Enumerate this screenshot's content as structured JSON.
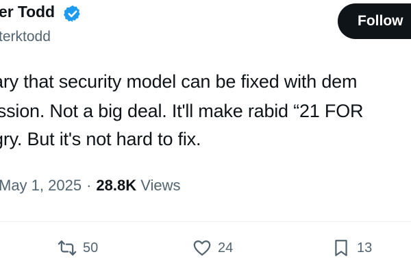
{
  "tweet": {
    "author": {
      "display_name": "er Todd",
      "handle": "terktodd",
      "verified": true,
      "verified_color": "#1d9bf0"
    },
    "follow_label": "Follow",
    "text_lines": [
      "ary that security model can be fixed with dem",
      "ission. Not a big deal. It'll make rabid “21 FOR",
      "gry. But it's not hard to fix."
    ],
    "meta": {
      "date": "May 1, 2025",
      "separator": "·",
      "views_count": "28.8K",
      "views_label": "Views"
    },
    "actions": {
      "retweet_icon": "retweet-icon",
      "retweets": "50",
      "like_icon": "heart-icon",
      "likes": "24",
      "bookmark_icon": "bookmark-icon",
      "bookmarks": "13"
    }
  }
}
